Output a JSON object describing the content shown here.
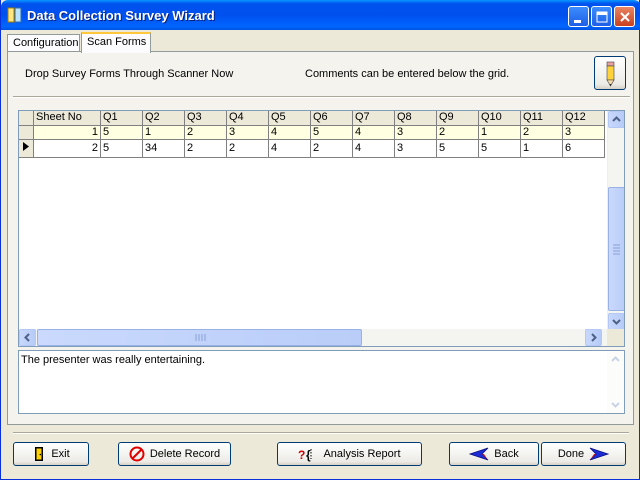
{
  "window": {
    "title": "Data Collection Survey Wizard"
  },
  "tabs": [
    {
      "label": "Configuration",
      "active": false
    },
    {
      "label": "Scan Forms",
      "active": true
    }
  ],
  "scan_forms": {
    "instruction": "Drop Survey Forms Through Scanner Now",
    "comment_hint": "Comments can be entered below the grid.",
    "comment_button_icon": "pencil-icon"
  },
  "grid": {
    "columns": [
      "Sheet No",
      "Q1",
      "Q2",
      "Q3",
      "Q4",
      "Q5",
      "Q6",
      "Q7",
      "Q8",
      "Q9",
      "Q10",
      "Q11",
      "Q12"
    ],
    "rows": [
      {
        "current": false,
        "cells": [
          "1",
          "5",
          "1",
          "2",
          "3",
          "4",
          "5",
          "4",
          "3",
          "2",
          "1",
          "2",
          "3"
        ]
      },
      {
        "current": true,
        "cells": [
          "2",
          "5",
          "34",
          "2",
          " 2",
          "4",
          "2",
          "4",
          "3",
          "5",
          "5",
          "1",
          "6"
        ]
      }
    ],
    "selected_row_color": "#ffffe1"
  },
  "comment_text": "The presenter was really entertaining.",
  "buttons": {
    "exit": {
      "label": "Exit",
      "icon": "exit-door-icon"
    },
    "delete": {
      "label": "Delete Record",
      "icon": "no-entry-icon"
    },
    "analysis": {
      "label": "Analysis Report",
      "icon": "report-icon"
    },
    "back": {
      "label": "Back",
      "icon": "back-arrow-icon"
    },
    "done": {
      "label": "Done",
      "icon": "forward-arrow-icon"
    }
  }
}
